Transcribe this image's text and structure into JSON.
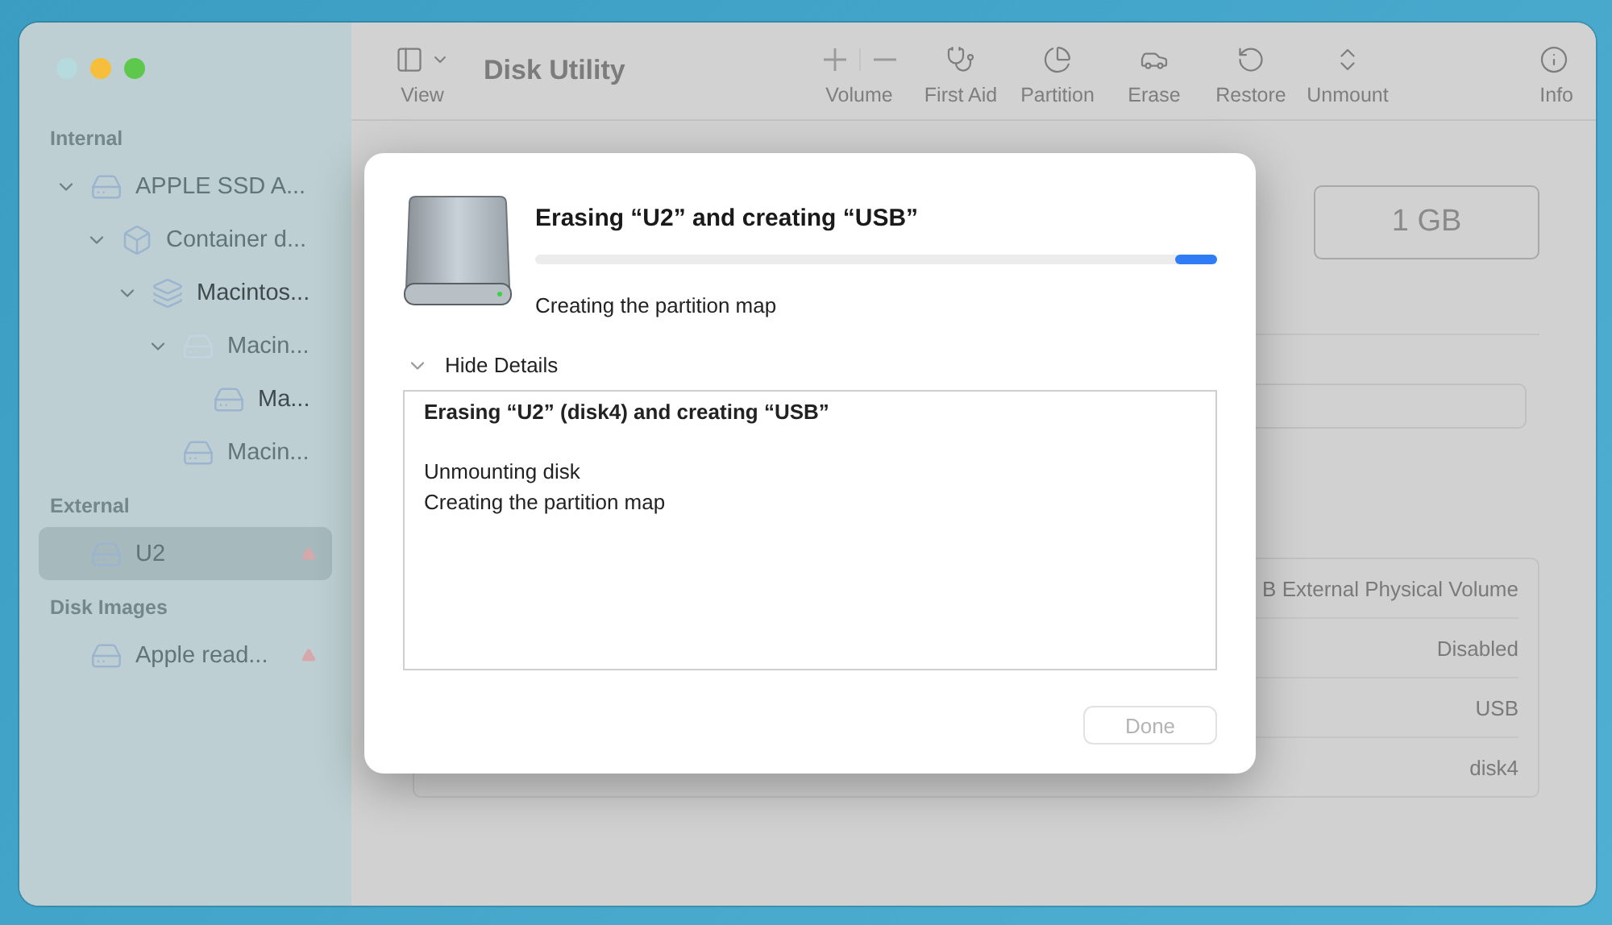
{
  "window": {
    "title": "Disk Utility",
    "controls": [
      {
        "color": "#b5dbde"
      },
      {
        "color": "#f7be3c"
      },
      {
        "color": "#5ec84d"
      }
    ]
  },
  "toolbar": {
    "view": {
      "label": "View"
    },
    "items": [
      {
        "kind": "volume",
        "label": "Volume"
      },
      {
        "kind": "first-aid",
        "label": "First Aid"
      },
      {
        "kind": "partition",
        "label": "Partition"
      },
      {
        "kind": "erase",
        "label": "Erase"
      },
      {
        "kind": "restore",
        "label": "Restore"
      },
      {
        "kind": "unmount",
        "label": "Unmount"
      },
      {
        "kind": "info",
        "label": "Info"
      }
    ]
  },
  "sidebar": {
    "sections": [
      {
        "title": "Internal",
        "items": [
          {
            "kind": "disk",
            "label": "APPLE SSD A...",
            "mounted": false,
            "expanded": true,
            "selected": false,
            "ejectable": false,
            "children": [
              {
                "kind": "container",
                "label": "Container d...",
                "mounted": false,
                "expanded": true,
                "selected": false,
                "ejectable": false,
                "children": [
                  {
                    "kind": "volume-group",
                    "label": "Macintos...",
                    "mounted": true,
                    "expanded": true,
                    "selected": false,
                    "ejectable": false,
                    "children": [
                      {
                        "kind": "volume",
                        "label": "Macin...",
                        "mounted": false,
                        "expanded": true,
                        "selected": false,
                        "ejectable": false,
                        "children": [
                          {
                            "kind": "disk",
                            "label": "Ma...",
                            "mounted": true,
                            "selected": false,
                            "ejectable": false
                          }
                        ]
                      },
                      {
                        "kind": "disk",
                        "label": "Macin...",
                        "mounted": false,
                        "selected": false,
                        "ejectable": false
                      }
                    ]
                  }
                ]
              }
            ]
          }
        ]
      },
      {
        "title": "External",
        "items": [
          {
            "kind": "disk",
            "label": "U2",
            "mounted": false,
            "selected": true,
            "ejectable": true
          }
        ]
      },
      {
        "title": "Disk Images",
        "items": [
          {
            "kind": "disk",
            "label": "Apple read...",
            "mounted": false,
            "selected": false,
            "ejectable": true
          }
        ]
      }
    ]
  },
  "detail": {
    "capacity": "1 GB",
    "info_rows": [
      {
        "value": "B External Physical Volume"
      },
      {
        "value": "Disabled"
      },
      {
        "value": "USB"
      },
      {
        "value": "disk4"
      }
    ]
  },
  "sheet": {
    "title": "Erasing “U2” and creating “USB”",
    "progress": {
      "indeterminate": true
    },
    "status": "Creating the partition map",
    "details": {
      "label": "Hide Details",
      "expanded": true,
      "log": [
        {
          "text": "Erasing “U2” (disk4) and creating “USB”",
          "bold": true
        },
        {
          "text": "Unmounting disk",
          "bold": false
        },
        {
          "text": "Creating the partition map",
          "bold": false
        }
      ]
    },
    "done": {
      "label": "Done",
      "disabled": true
    }
  }
}
